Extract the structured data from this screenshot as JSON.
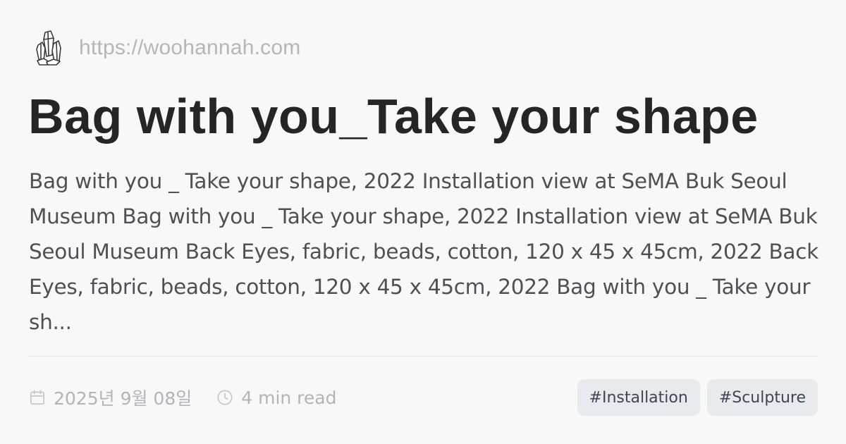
{
  "site": {
    "url": "https://woohannah.com",
    "logo_icon": "crystal-cluster-icon"
  },
  "post": {
    "title": "Bag with you_Take your shape",
    "excerpt": "Bag with you _ Take your shape, 2022 Installation view at SeMA Buk Seoul Museum Bag with you _ Take your shape, 2022 Installation view at SeMA Buk Seoul Museum Back Eyes, fabric, beads, cotton, 120 x 45 x 45cm, 2022 Back Eyes, fabric, beads, cotton, 120 x 45 x 45cm, 2022 Bag with you _ Take your sh...",
    "date": "2025년 9월 08일",
    "date_icon": "calendar-icon",
    "read_time": "4 min read",
    "read_time_icon": "clock-icon",
    "tags": [
      "#Installation",
      "#Sculpture"
    ]
  },
  "colors": {
    "background": "#f9f8f9",
    "title": "#252525",
    "excerpt": "#505053",
    "muted": "#b4b4b7",
    "tag_bg": "#e9eaed",
    "tag_text": "#3c4656"
  }
}
